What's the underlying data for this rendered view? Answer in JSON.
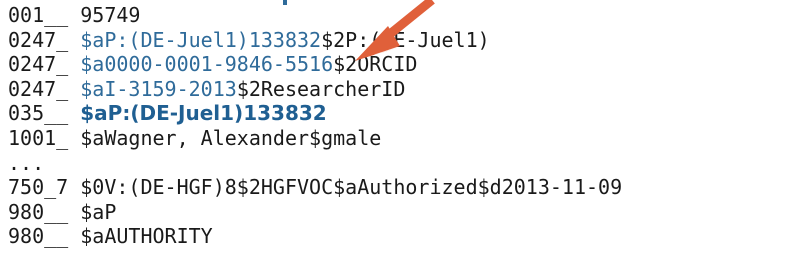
{
  "record": {
    "lines": [
      {
        "tag": "001__",
        "hl": "",
        "rest": "95749"
      },
      {
        "tag": "0247_",
        "hl": "$aP:(DE-Juel1)133832",
        "rest": "$2P:(DE-Juel1)"
      },
      {
        "tag": "0247_",
        "hl": "$a0000-0001-9846-5516",
        "rest": "$2ORCID"
      },
      {
        "tag": "0247_",
        "hl": "$aI-3159-2013",
        "rest": "$2ResearcherID"
      },
      {
        "tag": "035__",
        "hl": "$aP:(DE-Juel1)133832",
        "rest": ""
      },
      {
        "tag": "1001_",
        "hl": "",
        "rest": "$aWagner, Alexander$gmale"
      },
      {
        "tag": "...",
        "hl": "",
        "rest": ""
      },
      {
        "tag": "750_7",
        "hl": "",
        "rest": "$0V:(DE-HGF)8$2HGFVOC$aAuthorized$d2013-11-09"
      },
      {
        "tag": "980__",
        "hl": "",
        "rest": "$aP"
      },
      {
        "tag": "980__",
        "hl": "",
        "rest": "$aAUTHORITY"
      }
    ]
  },
  "colors": {
    "highlight": "#2f6b9a",
    "arrow": "#e0603a",
    "text": "#1a1a1a"
  },
  "annotation": {
    "icon": "arrow-pointer-icon"
  }
}
